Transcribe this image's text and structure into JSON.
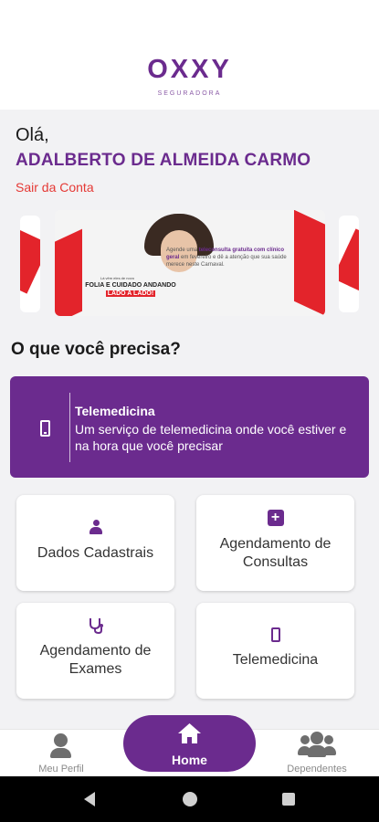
{
  "header": {
    "logo": "OXXY",
    "logo_sub": "SEGURADORA"
  },
  "greeting": {
    "hello": "Olá,",
    "user_name": "ADALBERTO DE ALMEIDA CARMO",
    "logout": "Sair da Conta"
  },
  "banner": {
    "small_text": "Lá vêm eles de novo",
    "tagline_1": "FOLIA E CUIDADO ANDANDO",
    "tagline_2": "LADO A LADO!",
    "copy_1": "Agende uma",
    "copy_bold": "teleconsulta gratuita com clínico geral",
    "copy_2": "em fevereiro e dê a atenção que sua saúde merece neste Carnaval."
  },
  "section": {
    "title": "O que você precisa?"
  },
  "telemedicina_card": {
    "title": "Telemedicina",
    "description": "Um serviço de telemedicina onde você estiver e na hora que você precisar",
    "icon": "phone-icon"
  },
  "tiles": [
    {
      "label": "Dados Cadastrais",
      "icon": "person-icon"
    },
    {
      "label_line1": "Agendamento de",
      "label_line2": "Consultas",
      "icon": "plus-square-icon"
    },
    {
      "label_line1": "Agendamento de",
      "label_line2": "Exames",
      "icon": "stethoscope-icon"
    },
    {
      "label": "Telemedicina",
      "icon": "phone-icon"
    }
  ],
  "bottom_nav": {
    "profile": "Meu Perfil",
    "home": "Home",
    "dependents": "Dependentes"
  },
  "colors": {
    "brand": "#6b2b8e",
    "logout": "#e53935",
    "banner_red": "#e3242b"
  }
}
